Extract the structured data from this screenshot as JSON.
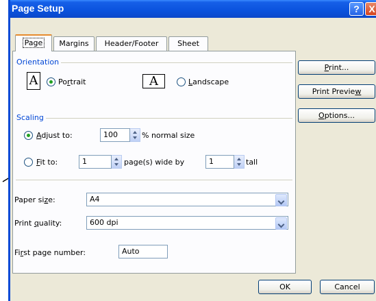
{
  "window": {
    "title": "Page Setup",
    "help_glyph": "?",
    "close_glyph": "X"
  },
  "tabs": [
    "Page",
    "Margins",
    "Header/Footer",
    "Sheet"
  ],
  "orientation": {
    "label": "Orientation",
    "icon_glyph": "A",
    "portrait_label_pre": "Po",
    "portrait_label_ul": "r",
    "portrait_label_post": "trait",
    "landscape_label_ul": "L",
    "landscape_label_post": "andscape",
    "selected": "portrait"
  },
  "scaling": {
    "label": "Scaling",
    "adjust_label_ul": "A",
    "adjust_label_post": "djust to:",
    "adjust_value": "100",
    "adjust_suffix": "% normal size",
    "fit_label_ul": "F",
    "fit_label_post": "it to:",
    "fit_wide_value": "1",
    "fit_wide_suffix": "page(s) wide by",
    "fit_tall_value": "1",
    "fit_tall_suffix": "tall",
    "selected": "adjust"
  },
  "paper_size": {
    "label_pre": "Paper si",
    "label_ul": "z",
    "label_post": "e:",
    "value": "A4"
  },
  "print_quality": {
    "label_pre": "Print ",
    "label_ul": "q",
    "label_post": "uality:",
    "value": "600 dpi"
  },
  "first_page": {
    "label_pre": "Fi",
    "label_ul": "r",
    "label_post": "st page number:",
    "value": "Auto"
  },
  "side_buttons": {
    "print_ul": "P",
    "print_post": "rint...",
    "preview_pre": "Print Previe",
    "preview_ul": "w",
    "options_ul": "O",
    "options_post": "ptions..."
  },
  "footer": {
    "ok": "OK",
    "cancel": "Cancel"
  }
}
